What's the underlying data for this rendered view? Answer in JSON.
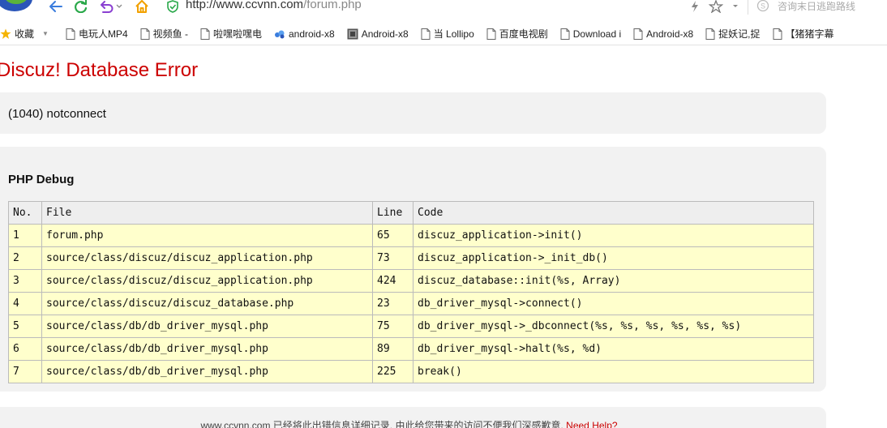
{
  "browser": {
    "url_host": "http://www.ccvnn.com",
    "url_path": "/forum.php",
    "search_placeholder": "咨询末日逃跑路线"
  },
  "bookmarks": {
    "favorites_label": "收藏",
    "items": [
      {
        "label": "电玩人MP4",
        "icon": "page-icon"
      },
      {
        "label": "视频鱼 -",
        "icon": "page-icon"
      },
      {
        "label": "啦嘿啦嘿电",
        "icon": "page-icon"
      },
      {
        "label": "android-x8",
        "icon": "cloud-icon"
      },
      {
        "label": "Android-x8",
        "icon": "image-icon"
      },
      {
        "label": "当 Lollipo",
        "icon": "page-icon"
      },
      {
        "label": "百度电视剧",
        "icon": "page-icon"
      },
      {
        "label": "Download i",
        "icon": "page-icon"
      },
      {
        "label": "Android-x8",
        "icon": "page-icon"
      },
      {
        "label": "捉妖记,捉",
        "icon": "page-icon"
      },
      {
        "label": "【猪猪字幕",
        "icon": "page-icon"
      }
    ]
  },
  "error": {
    "title": "Discuz! Database Error",
    "message": "(1040) notconnect"
  },
  "debug": {
    "title": "PHP Debug",
    "columns": [
      "No.",
      "File",
      "Line",
      "Code"
    ],
    "rows": [
      [
        "1",
        "forum.php",
        "65",
        "discuz_application->init()"
      ],
      [
        "2",
        "source/class/discuz/discuz_application.php",
        "73",
        "discuz_application->_init_db()"
      ],
      [
        "3",
        "source/class/discuz/discuz_application.php",
        "424",
        "discuz_database::init(%s, Array)"
      ],
      [
        "4",
        "source/class/discuz/discuz_database.php",
        "23",
        "db_driver_mysql->connect()"
      ],
      [
        "5",
        "source/class/db/db_driver_mysql.php",
        "75",
        "db_driver_mysql->_dbconnect(%s, %s, %s, %s, %s, %s)"
      ],
      [
        "6",
        "source/class/db/db_driver_mysql.php",
        "89",
        "db_driver_mysql->halt(%s, %d)"
      ],
      [
        "7",
        "source/class/db/db_driver_mysql.php",
        "225",
        "break()"
      ]
    ]
  },
  "footer": {
    "text": "www.ccvnn.com 已经将此出错信息详细记录, 由此给您带来的访问不便我们深感歉意.",
    "help_link": "Need Help?"
  },
  "colors": {
    "error_red": "#cc0000",
    "panel_bg": "#f2f2f2",
    "row_bg": "#ffffcc",
    "nav_blue": "#3b7ddd",
    "refresh_green": "#2aa84a",
    "undo_purple": "#8a3fd1",
    "home_orange": "#f2a100"
  }
}
